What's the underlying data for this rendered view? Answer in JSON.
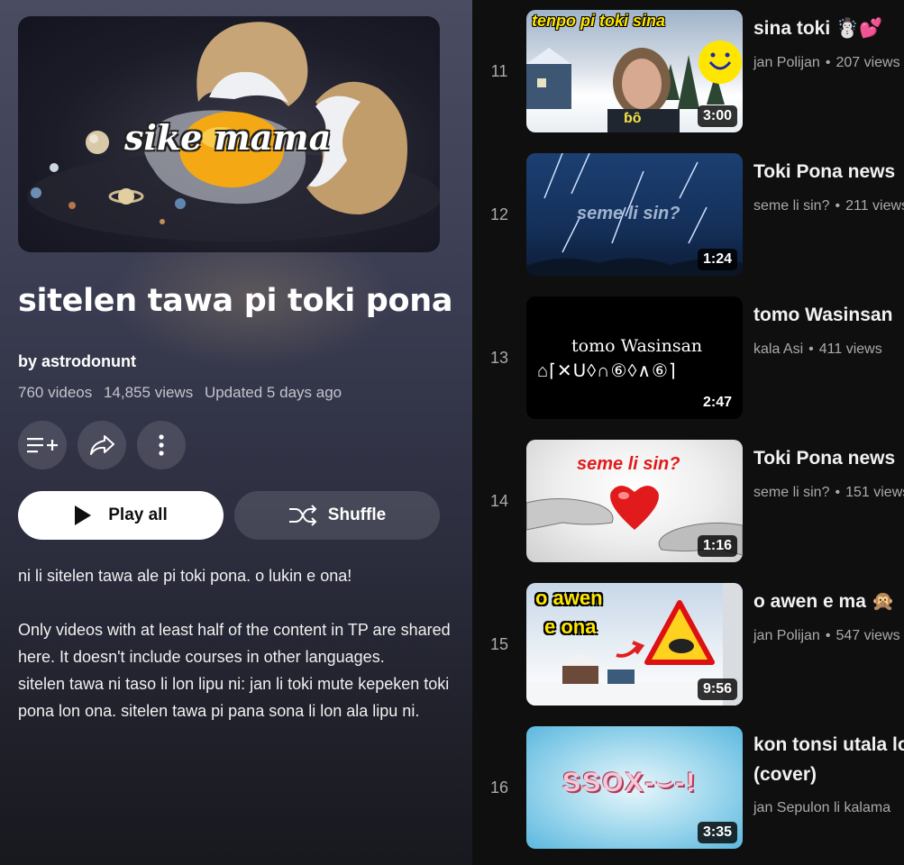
{
  "playlist": {
    "hero_caption": "sike mama",
    "title": "sitelen tawa pi toki pona",
    "owner_prefix": "by",
    "owner": "astrodonunt",
    "video_count": "760 videos",
    "view_count": "14,855 views",
    "updated": "Updated 5 days ago",
    "play_all_label": "Play all",
    "shuffle_label": "Shuffle",
    "description": "ni li sitelen tawa ale pi toki pona. o lukin e ona!\n\nOnly videos with at least half of the content in TP are shared here. It doesn't include courses in other languages.\nsitelen tawa ni taso li lon lipu ni: jan li toki mute kepeken toki pona lon ona. sitelen tawa pi pana sona li lon ala lipu ni."
  },
  "icons": {
    "save": "playlist-add-icon",
    "share": "share-icon",
    "more": "more-vert-icon",
    "play": "play-icon",
    "shuffle": "shuffle-icon"
  },
  "videos": [
    {
      "index": "11",
      "title": "sina toki ☃️💕",
      "channel": "jan Polijan",
      "views": "207 views",
      "duration": "3:00",
      "thumb_text": "tenpo pi toki sina",
      "emoji": "ɓȏ"
    },
    {
      "index": "12",
      "title": "Toki Pona news",
      "channel": "seme li sin?",
      "views": "211 views",
      "duration": "1:24",
      "thumb_text": "seme li sin?"
    },
    {
      "index": "13",
      "title": "tomo Wasinsan",
      "channel": "kala Asi",
      "views": "411 views",
      "duration": "2:47",
      "thumb_text": "tomo Wasinsan",
      "thumb_glyphs": "⌂⌈✕ᑌ◊∩⑥◊∧⑥⌉"
    },
    {
      "index": "14",
      "title": "Toki Pona news",
      "channel": "seme li sin?",
      "views": "151 views",
      "duration": "1:16",
      "thumb_text": "seme li sin?"
    },
    {
      "index": "15",
      "title": "o awen e ma 🙊",
      "channel": "jan Polijan",
      "views": "547 views",
      "duration": "9:56",
      "thumb_text_1": "o awen",
      "thumb_text_2": "e ona"
    },
    {
      "index": "16",
      "title": "kon tonsi utala lon (cover)",
      "channel": "jan Sepulon li kalama",
      "views": "",
      "duration": "3:35",
      "thumb_glyphs": "SSOX-⌣-!"
    }
  ],
  "colors": {
    "background": "#0f0f0f",
    "panel_top": "#4a4c62",
    "meta_text": "#aaaaaa"
  }
}
